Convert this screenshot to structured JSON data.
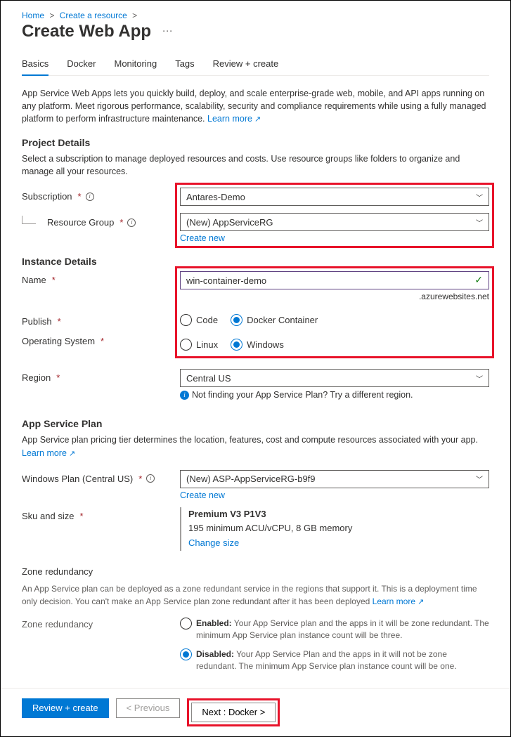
{
  "breadcrumb": {
    "home": "Home",
    "create": "Create a resource"
  },
  "title": "Create Web App",
  "tabs": [
    "Basics",
    "Docker",
    "Monitoring",
    "Tags",
    "Review + create"
  ],
  "intro": "App Service Web Apps lets you quickly build, deploy, and scale enterprise-grade web, mobile, and API apps running on any platform. Meet rigorous performance, scalability, security and compliance requirements while using a fully managed platform to perform infrastructure maintenance.  ",
  "learn_more": "Learn more",
  "project": {
    "heading": "Project Details",
    "desc": "Select a subscription to manage deployed resources and costs. Use resource groups like folders to organize and manage all your resources.",
    "subscription_label": "Subscription",
    "subscription_value": "Antares-Demo",
    "rg_label": "Resource Group",
    "rg_value": "(New) AppServiceRG",
    "create_new": "Create new"
  },
  "instance": {
    "heading": "Instance Details",
    "name_label": "Name",
    "name_value": "win-container-demo",
    "suffix": ".azurewebsites.net",
    "publish_label": "Publish",
    "publish_options": [
      "Code",
      "Docker Container"
    ],
    "publish_selected": "Docker Container",
    "os_label": "Operating System",
    "os_options": [
      "Linux",
      "Windows"
    ],
    "os_selected": "Windows",
    "region_label": "Region",
    "region_value": "Central US",
    "region_hint": "Not finding your App Service Plan? Try a different region."
  },
  "plan": {
    "heading": "App Service Plan",
    "desc": "App Service plan pricing tier determines the location, features, cost and compute resources associated with your app. ",
    "learn_more": "Learn more",
    "winplan_label": "Windows Plan (Central US)",
    "winplan_value": "(New) ASP-AppServiceRG-b9f9",
    "create_new": "Create new",
    "sku_label": "Sku and size",
    "sku_name": "Premium V3 P1V3",
    "sku_desc": "195 minimum ACU/vCPU, 8 GB memory",
    "change_size": "Change size"
  },
  "zone": {
    "heading": "Zone redundancy",
    "desc": "An App Service plan can be deployed as a zone redundant service in the regions that support it. This is a deployment time only decision. You can't make an App Service plan zone redundant after it has been deployed ",
    "learn_more": "Learn more",
    "label": "Zone redundancy",
    "enabled_bold": "Enabled:",
    "enabled_text": " Your App Service plan and the apps in it will be zone redundant. The minimum App Service plan instance count will be three.",
    "disabled_bold": "Disabled:",
    "disabled_text": " Your App Service Plan and the apps in it will not be zone redundant. The minimum App Service plan instance count will be one.",
    "selected": "Disabled"
  },
  "footer": {
    "review": "Review + create",
    "prev": "< Previous",
    "next": "Next : Docker >"
  }
}
